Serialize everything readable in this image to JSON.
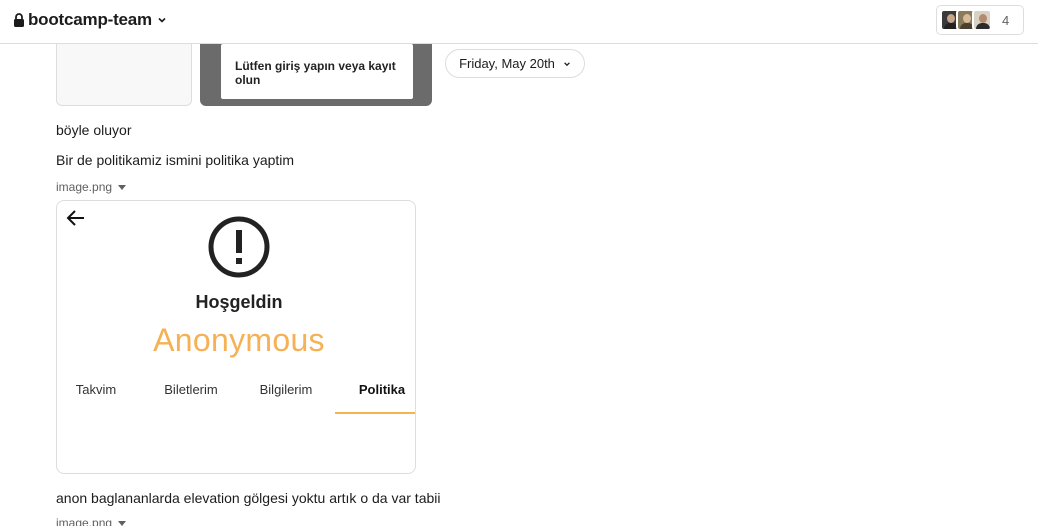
{
  "header": {
    "channel_name": "bootcamp-team",
    "member_count": "4",
    "icons": [
      "lock-icon",
      "chevron-down-icon"
    ]
  },
  "thumbnail_dialog": {
    "text": "Lütfen giriş yapın veya kayıt olun"
  },
  "date_divider": {
    "label": "Friday, May 20th"
  },
  "messages": [
    {
      "text": "böyle oluyor"
    },
    {
      "text": "Bir de politikamiz ismini politika yaptim"
    },
    {
      "text": "anon baglananlarda elevation gölgesi yoktu artık o da var tabii"
    }
  ],
  "files": [
    {
      "name": "image.png"
    },
    {
      "name": "image.png"
    }
  ],
  "attachment": {
    "welcome": "Hoşgeldin",
    "user": "Anonymous",
    "tabs": [
      "Takvim",
      "Biletlerim",
      "Bilgilerim",
      "Politika"
    ],
    "active_tab": "Politika",
    "accent_color": "#f5b154"
  }
}
